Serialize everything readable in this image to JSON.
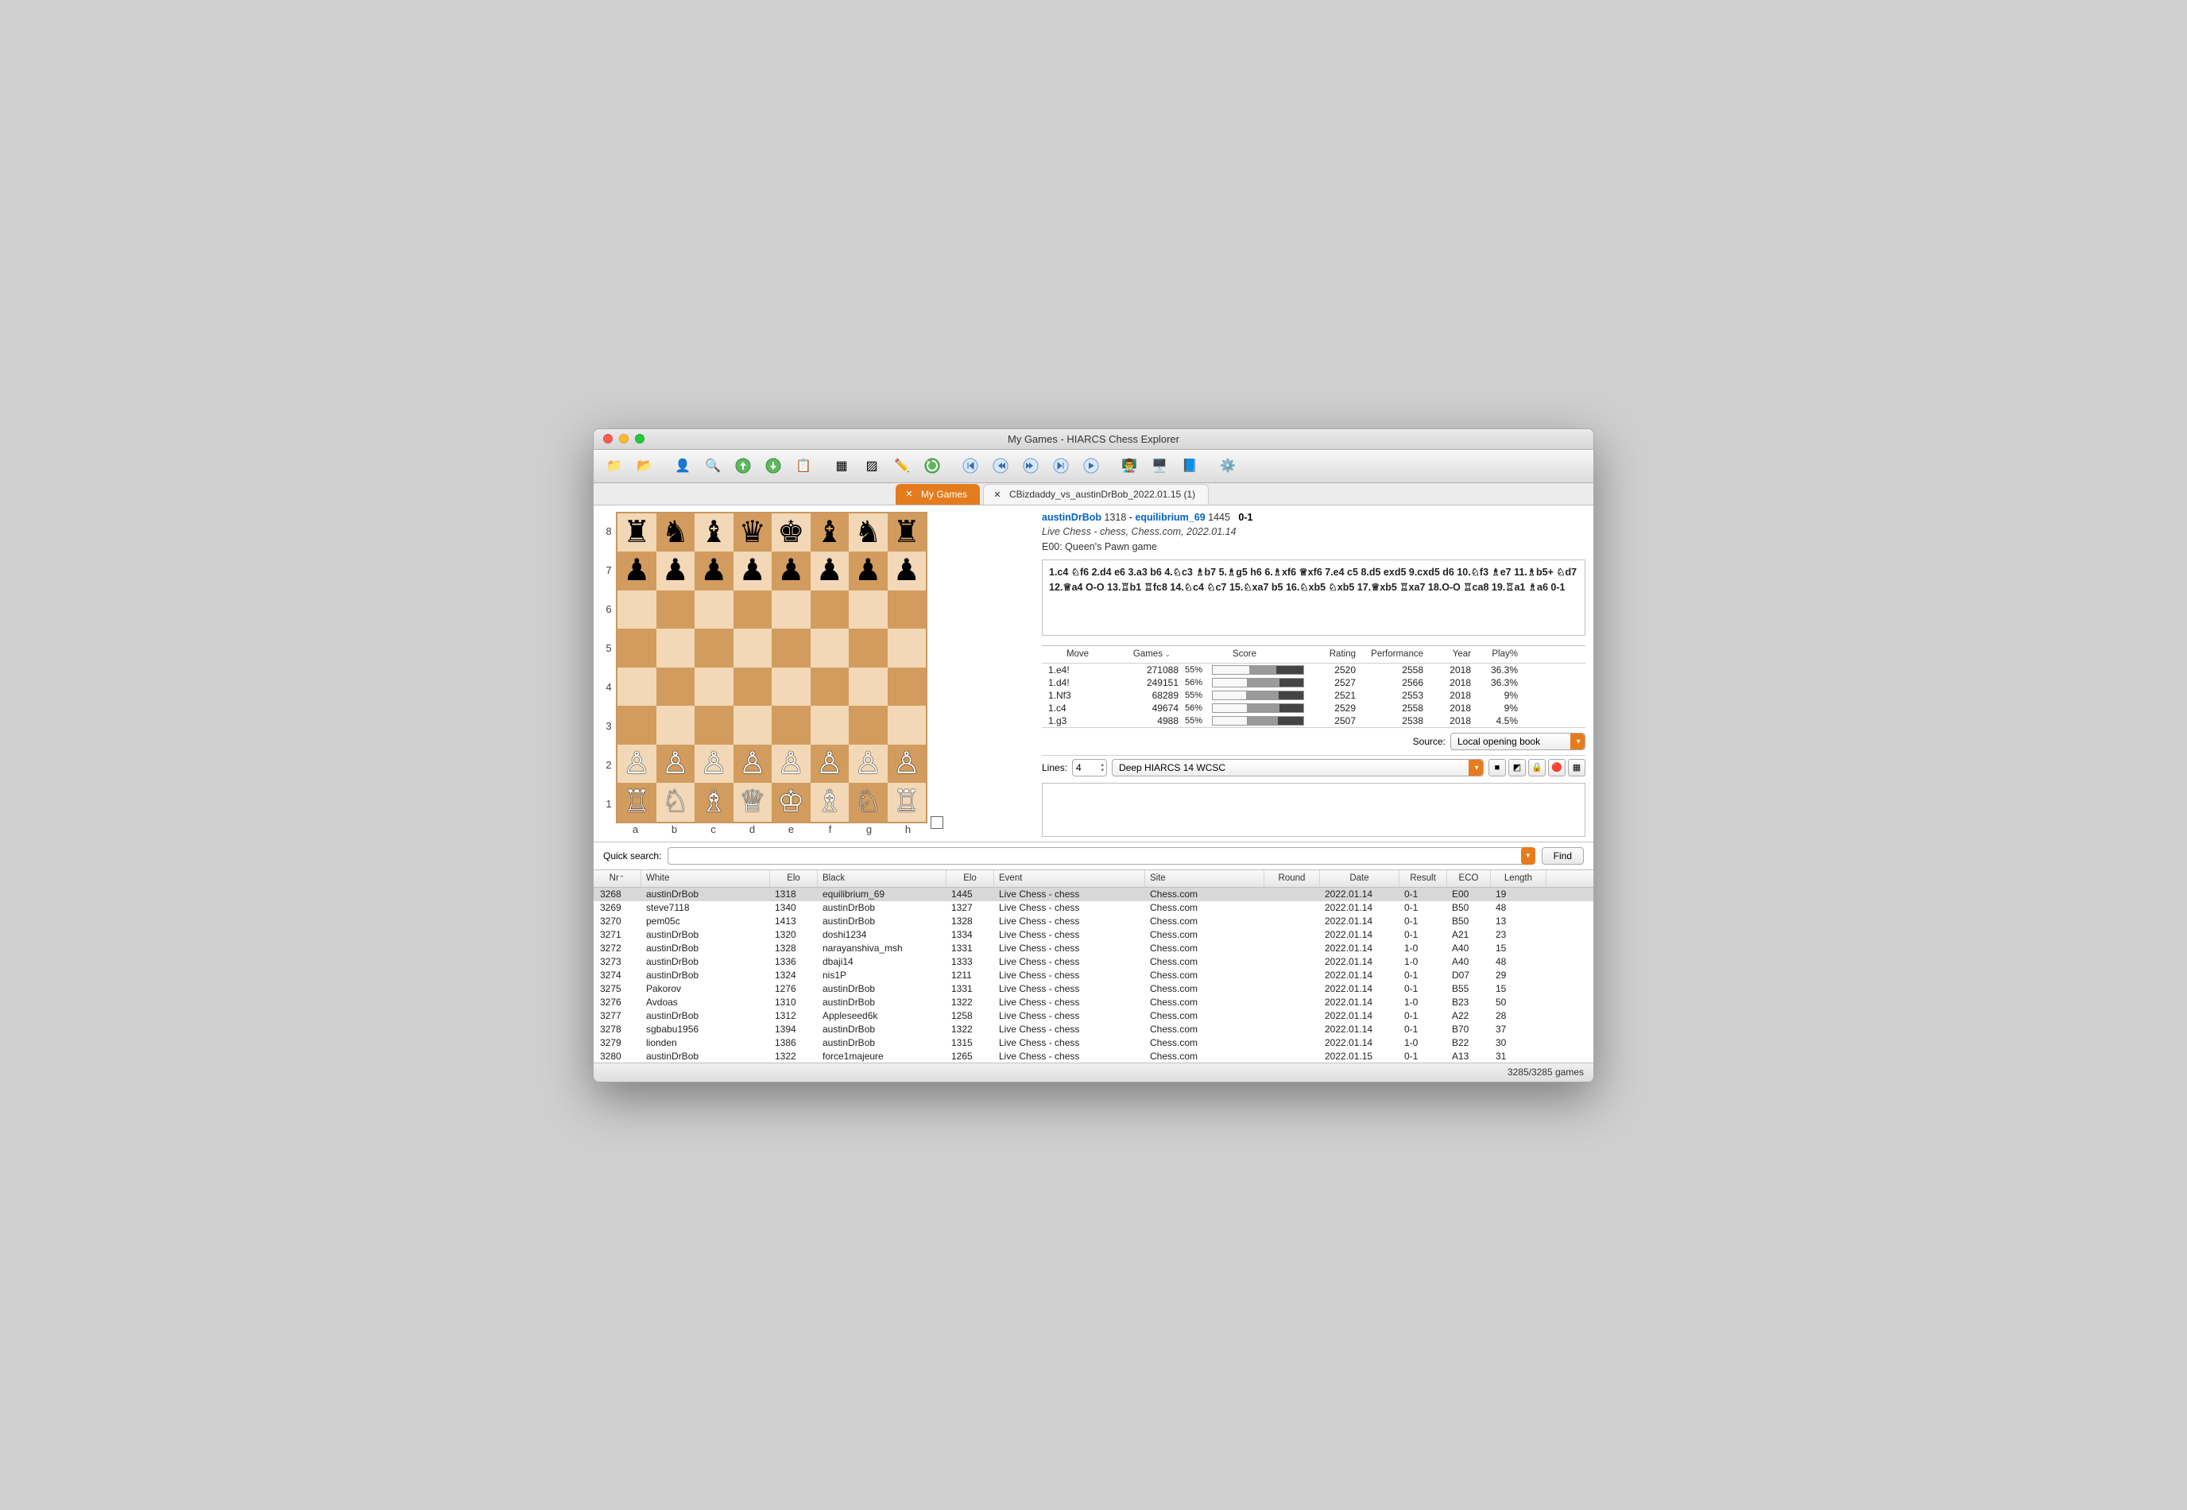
{
  "window_title": "My Games - HIARCS Chess Explorer",
  "tabs": {
    "active": "My Games",
    "inactive": "CBizdaddy_vs_austinDrBob_2022.01.15 (1)"
  },
  "game_header": {
    "white_name": "austinDrBob",
    "white_elo": "1318",
    "sep": " - ",
    "black_name": "equilibrium_69",
    "black_elo": "1445",
    "result": "0-1",
    "event_line": "Live Chess - chess, Chess.com, 2022.01.14",
    "opening_line": "E00: Queen's Pawn game"
  },
  "moves_text": "1.c4 ♘f6 2.d4 e6 3.a3 b6 4.♘c3 ♗b7 5.♗g5 h6 6.♗xf6 ♕xf6 7.e4 c5 8.d5 exd5 9.cxd5 d6 10.♘f3 ♗e7 11.♗b5+ ♘d7 12.♕a4 O-O 13.♖b1 ♖fc8 14.♘c4 ♘c7 15.♘xa7 b5 16.♘xb5 ♘xb5 17.♕xb5 ♖xa7 18.O-O ♖ca8 19.♖a1 ♗a6 0-1",
  "opening_book": {
    "headers": {
      "move": "Move",
      "games": "Games",
      "score": "Score",
      "rating": "Rating",
      "perf": "Performance",
      "year": "Year",
      "play": "Play%"
    },
    "rows": [
      {
        "move": "1.e4!",
        "games": "271088",
        "score": "55%",
        "white": 40,
        "draw": 30,
        "black": 30,
        "rating": "2520",
        "perf": "2558",
        "year": "2018",
        "play": "36.3%"
      },
      {
        "move": "1.d4!",
        "games": "249151",
        "score": "56%",
        "white": 38,
        "draw": 36,
        "black": 26,
        "rating": "2527",
        "perf": "2566",
        "year": "2018",
        "play": "36.3%"
      },
      {
        "move": "1.Nf3",
        "games": "68289",
        "score": "55%",
        "white": 37,
        "draw": 36,
        "black": 27,
        "rating": "2521",
        "perf": "2553",
        "year": "2018",
        "play": "9%"
      },
      {
        "move": "1.c4",
        "games": "49674",
        "score": "56%",
        "white": 38,
        "draw": 36,
        "black": 26,
        "rating": "2529",
        "perf": "2558",
        "year": "2018",
        "play": "9%"
      },
      {
        "move": "1.g3",
        "games": "4988",
        "score": "55%",
        "white": 38,
        "draw": 34,
        "black": 28,
        "rating": "2507",
        "perf": "2538",
        "year": "2018",
        "play": "4.5%"
      }
    ],
    "source_label": "Source:",
    "source_value": "Local opening book"
  },
  "engine": {
    "lines_label": "Lines:",
    "lines_value": "4",
    "engine_name": "Deep HIARCS 14 WCSC"
  },
  "quick_search": {
    "label": "Quick search:",
    "find_label": "Find"
  },
  "board": {
    "ranks": [
      "8",
      "7",
      "6",
      "5",
      "4",
      "3",
      "2",
      "1"
    ],
    "files": [
      "a",
      "b",
      "c",
      "d",
      "e",
      "f",
      "g",
      "h"
    ],
    "position": [
      [
        "♜",
        "♞",
        "♝",
        "♛",
        "♚",
        "♝",
        "♞",
        "♜"
      ],
      [
        "♟",
        "♟",
        "♟",
        "♟",
        "♟",
        "♟",
        "♟",
        "♟"
      ],
      [
        "",
        "",
        "",
        "",
        "",
        "",
        "",
        ""
      ],
      [
        "",
        "",
        "",
        "",
        "",
        "",
        "",
        ""
      ],
      [
        "",
        "",
        "",
        "",
        "",
        "",
        "",
        ""
      ],
      [
        "",
        "",
        "",
        "",
        "",
        "",
        "",
        ""
      ],
      [
        "♙",
        "♙",
        "♙",
        "♙",
        "♙",
        "♙",
        "♙",
        "♙"
      ],
      [
        "♖",
        "♘",
        "♗",
        "♕",
        "♔",
        "♗",
        "♘",
        "♖"
      ]
    ]
  },
  "games_table": {
    "headers": {
      "nr": "Nr",
      "white": "White",
      "elo1": "Elo",
      "black": "Black",
      "elo2": "Elo",
      "event": "Event",
      "site": "Site",
      "round": "Round",
      "date": "Date",
      "result": "Result",
      "eco": "ECO",
      "length": "Length"
    },
    "rows": [
      {
        "nr": "3268",
        "white": "austinDrBob",
        "elo1": "1318",
        "black": "equilibrium_69",
        "elo2": "1445",
        "event": "Live Chess - chess",
        "site": "Chess.com",
        "round": "",
        "date": "2022.01.14",
        "result": "0-1",
        "eco": "E00",
        "length": "19",
        "selected": true
      },
      {
        "nr": "3269",
        "white": "steve7118",
        "elo1": "1340",
        "black": "austinDrBob",
        "elo2": "1327",
        "event": "Live Chess - chess",
        "site": "Chess.com",
        "round": "",
        "date": "2022.01.14",
        "result": "0-1",
        "eco": "B50",
        "length": "48"
      },
      {
        "nr": "3270",
        "white": "pem05c",
        "elo1": "1413",
        "black": "austinDrBob",
        "elo2": "1328",
        "event": "Live Chess - chess",
        "site": "Chess.com",
        "round": "",
        "date": "2022.01.14",
        "result": "0-1",
        "eco": "B50",
        "length": "13"
      },
      {
        "nr": "3271",
        "white": "austinDrBob",
        "elo1": "1320",
        "black": "doshi1234",
        "elo2": "1334",
        "event": "Live Chess - chess",
        "site": "Chess.com",
        "round": "",
        "date": "2022.01.14",
        "result": "0-1",
        "eco": "A21",
        "length": "23"
      },
      {
        "nr": "3272",
        "white": "austinDrBob",
        "elo1": "1328",
        "black": "narayanshiva_msh",
        "elo2": "1331",
        "event": "Live Chess - chess",
        "site": "Chess.com",
        "round": "",
        "date": "2022.01.14",
        "result": "1-0",
        "eco": "A40",
        "length": "15"
      },
      {
        "nr": "3273",
        "white": "austinDrBob",
        "elo1": "1336",
        "black": "dbaji14",
        "elo2": "1333",
        "event": "Live Chess - chess",
        "site": "Chess.com",
        "round": "",
        "date": "2022.01.14",
        "result": "1-0",
        "eco": "A40",
        "length": "48"
      },
      {
        "nr": "3274",
        "white": "austinDrBob",
        "elo1": "1324",
        "black": "nis1P",
        "elo2": "1211",
        "event": "Live Chess - chess",
        "site": "Chess.com",
        "round": "",
        "date": "2022.01.14",
        "result": "0-1",
        "eco": "D07",
        "length": "29"
      },
      {
        "nr": "3275",
        "white": "Pakorov",
        "elo1": "1276",
        "black": "austinDrBob",
        "elo2": "1331",
        "event": "Live Chess - chess",
        "site": "Chess.com",
        "round": "",
        "date": "2022.01.14",
        "result": "0-1",
        "eco": "B55",
        "length": "15"
      },
      {
        "nr": "3276",
        "white": "Avdoas",
        "elo1": "1310",
        "black": "austinDrBob",
        "elo2": "1322",
        "event": "Live Chess - chess",
        "site": "Chess.com",
        "round": "",
        "date": "2022.01.14",
        "result": "1-0",
        "eco": "B23",
        "length": "50"
      },
      {
        "nr": "3277",
        "white": "austinDrBob",
        "elo1": "1312",
        "black": "Appleseed6k",
        "elo2": "1258",
        "event": "Live Chess - chess",
        "site": "Chess.com",
        "round": "",
        "date": "2022.01.14",
        "result": "0-1",
        "eco": "A22",
        "length": "28"
      },
      {
        "nr": "3278",
        "white": "sgbabu1956",
        "elo1": "1394",
        "black": "austinDrBob",
        "elo2": "1322",
        "event": "Live Chess - chess",
        "site": "Chess.com",
        "round": "",
        "date": "2022.01.14",
        "result": "0-1",
        "eco": "B70",
        "length": "37"
      },
      {
        "nr": "3279",
        "white": "lionden",
        "elo1": "1386",
        "black": "austinDrBob",
        "elo2": "1315",
        "event": "Live Chess - chess",
        "site": "Chess.com",
        "round": "",
        "date": "2022.01.14",
        "result": "1-0",
        "eco": "B22",
        "length": "30"
      },
      {
        "nr": "3280",
        "white": "austinDrBob",
        "elo1": "1322",
        "black": "force1majeure",
        "elo2": "1265",
        "event": "Live Chess - chess",
        "site": "Chess.com",
        "round": "",
        "date": "2022.01.15",
        "result": "0-1",
        "eco": "A13",
        "length": "31"
      }
    ]
  },
  "statusbar": "3285/3285 games"
}
